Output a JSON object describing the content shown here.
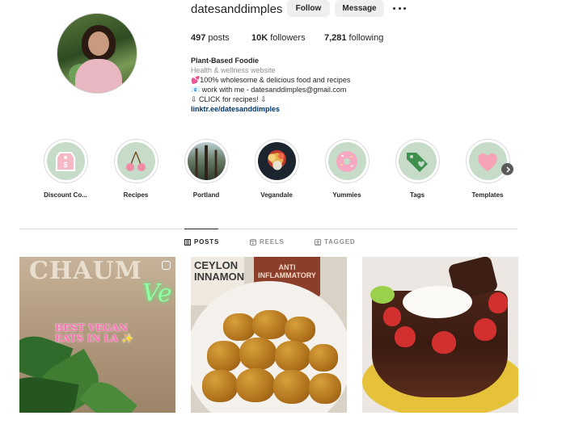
{
  "profile": {
    "username": "datesanddimples",
    "follow_label": "Follow",
    "message_label": "Message",
    "stats": {
      "posts_count": "497",
      "posts_label": "posts",
      "followers_count": "10K",
      "followers_label": "followers",
      "following_count": "7,281",
      "following_label": "following"
    },
    "bio": {
      "name": "Plant-Based Foodie",
      "category": "Health & wellness website",
      "line1": "💕100% wholesome & delicious food and recipes",
      "line2": "📧 work with me - datesanddimples@gmail.com",
      "line3": "⇩ CLICK for recipes! ⇩",
      "link": "linktr.ee/datesanddimples"
    }
  },
  "highlights": [
    {
      "label": "Discount Co...",
      "icon": "price-tag-icon"
    },
    {
      "label": "Recipes",
      "icon": "cherries-icon"
    },
    {
      "label": "Portland",
      "icon": "forest-photo"
    },
    {
      "label": "Vegandale",
      "icon": "food-photo"
    },
    {
      "label": "Yummies",
      "icon": "donut-icon"
    },
    {
      "label": "Tags",
      "icon": "tag-heart-icon"
    },
    {
      "label": "Templates",
      "icon": "heart-icon"
    }
  ],
  "tabs": [
    {
      "label": "POSTS",
      "active": true
    },
    {
      "label": "REELS",
      "active": false
    },
    {
      "label": "TAGGED",
      "active": false
    }
  ],
  "posts": {
    "post1": {
      "sign": "CHAUM",
      "neon": "Ve",
      "overlay_line1": "BEST VEGAN",
      "overlay_line2": "EATS IN LA ✨"
    },
    "post2": {
      "jar1_line1": "CEYLON",
      "jar1_line2": "INNAMON",
      "jar2_line1": "ANTI",
      "jar2_line2": "INFLAMMATORY"
    }
  },
  "colors": {
    "highlight_bg": "#c6dcc8",
    "link": "#00376b",
    "accent_pink": "#f27fa0"
  }
}
